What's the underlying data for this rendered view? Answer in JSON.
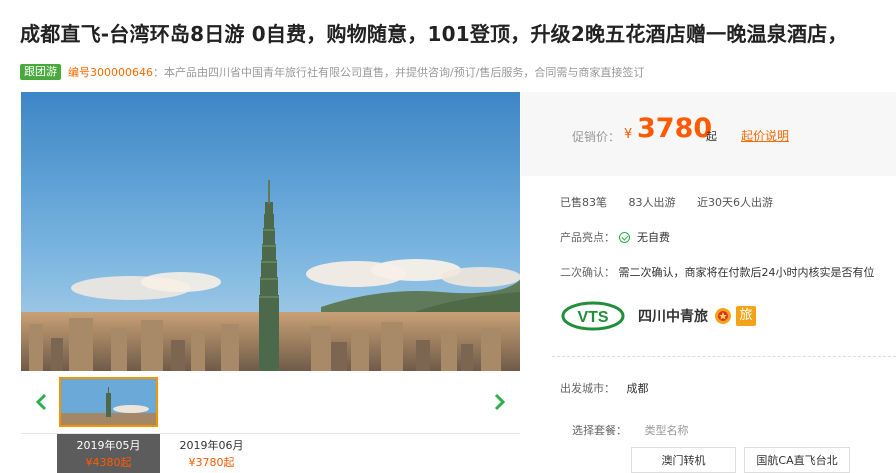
{
  "title": "成都直飞-台湾环岛8日游 0自费，购物随意，101登顶，升级2晚五花酒店赠一晚温泉酒店，",
  "badge": "跟团游",
  "product_code": "编号300000646",
  "product_note": "：本产品由四川省中国青年旅行社有限公司直售，并提供咨询/预订/售后服务，合同需与商家直接签订",
  "gallery": {
    "prev_icon": "chevron-left-icon",
    "next_icon": "chevron-right-icon"
  },
  "months": [
    {
      "month": "2019年05月",
      "price": "¥4380起",
      "active": true
    },
    {
      "month": "2019年06月",
      "price": "¥3780起",
      "active": false
    }
  ],
  "price": {
    "label": "促销价：",
    "currency": "¥",
    "amount": "3780",
    "suffix": "起",
    "explain_link": "起价说明"
  },
  "stats": {
    "sold": "已售83笔",
    "travelers": "83人出游",
    "recent": "近30天6人出游"
  },
  "highlight": {
    "label": "产品亮点：",
    "value": "无自费"
  },
  "confirm": {
    "label": "二次确认：",
    "value": "需二次确认，商家将在付款后24小时内核实是否有位"
  },
  "agency": {
    "name": "四川中青旅",
    "logo_text": "VTS",
    "level_badge": "旅"
  },
  "departure": {
    "label": "出发城市：",
    "value": "成都"
  },
  "package": {
    "label": "选择套餐：",
    "type_label": "类型名称",
    "options": [
      "澳门转机",
      "国航CA直飞台北"
    ]
  },
  "colors": {
    "accent": "#ff5a00",
    "badge_green": "#49a93c",
    "active_month_bg": "#5c5c5c",
    "thumb_border": "#f29500"
  }
}
